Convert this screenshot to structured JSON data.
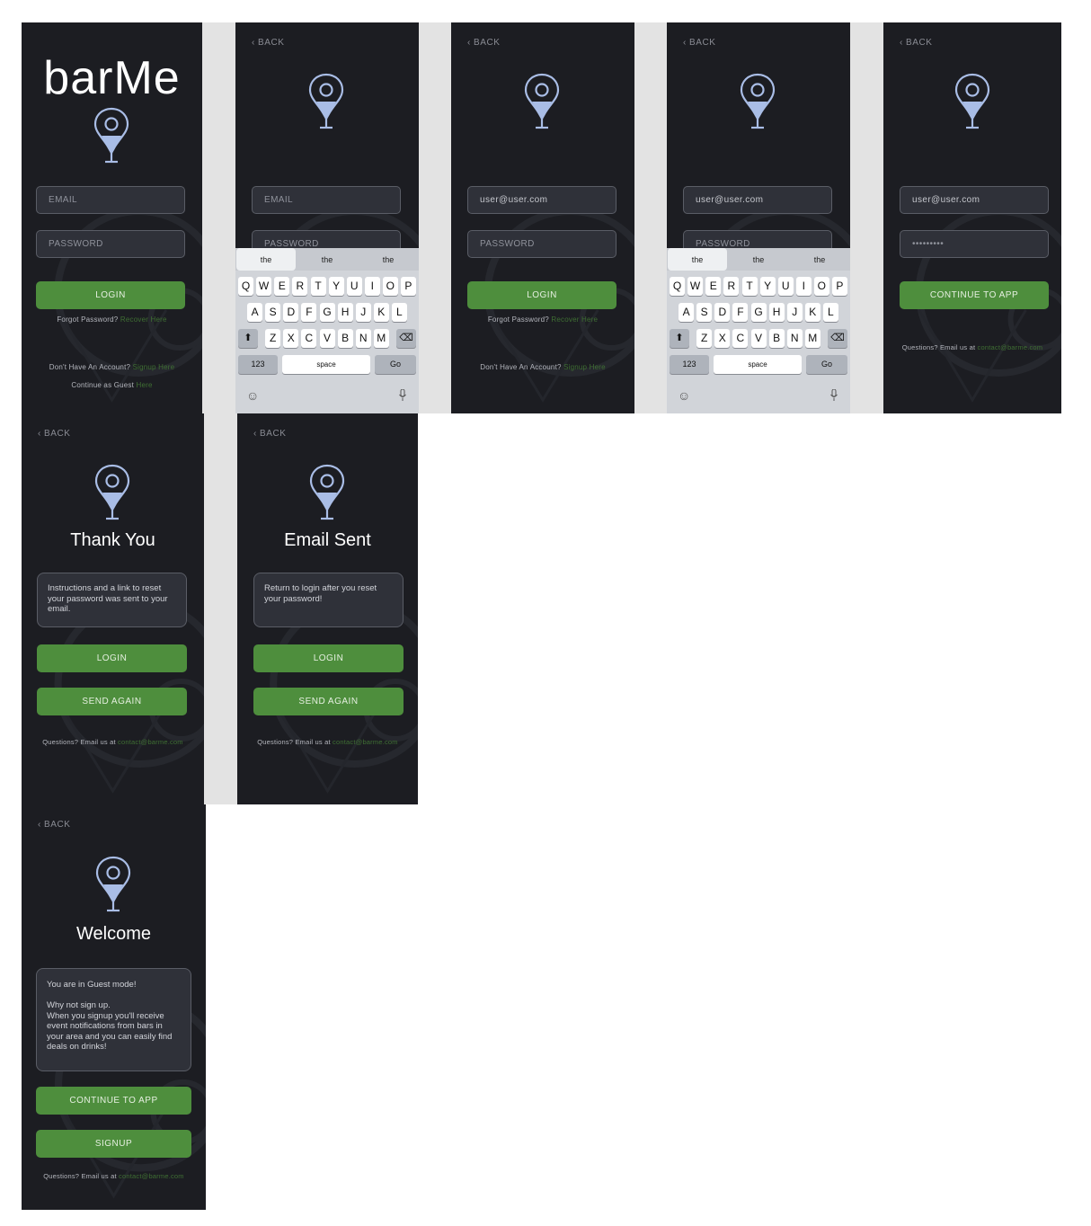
{
  "app": {
    "brand": "barMe",
    "back_label": "BACK",
    "email_placeholder": "EMAIL",
    "password_placeholder": "PASSWORD",
    "user_email": "user@user.com",
    "password_masked": "•••••••••",
    "login_label": "LOGIN",
    "continue_label": "CONTINUE TO APP",
    "send_again_label": "SEND AGAIN",
    "signup_label": "SIGNUP",
    "forgot_text": "Forgot Password?",
    "recover_link": "Recover Here",
    "no_account_text": "Don't Have An Account?",
    "signup_link": "Signup Here",
    "guest_text": "Continue as Guest",
    "guest_link": "Here",
    "questions_text": "Questions? Email us at",
    "contact_email": "contact@barme.com"
  },
  "keyboard": {
    "suggestions": [
      "the",
      "the",
      "the"
    ],
    "row1": [
      "Q",
      "W",
      "E",
      "R",
      "T",
      "Y",
      "U",
      "I",
      "O",
      "P"
    ],
    "row2": [
      "A",
      "S",
      "D",
      "F",
      "G",
      "H",
      "J",
      "K",
      "L"
    ],
    "row3": [
      "Z",
      "X",
      "C",
      "V",
      "B",
      "N",
      "M"
    ],
    "numbers_label": "123",
    "space_label": "space",
    "go_label": "Go"
  },
  "thank_you": {
    "title": "Thank You",
    "message": "Instructions and a link to reset your password was sent to your email."
  },
  "email_sent": {
    "title": "Email Sent",
    "message": "Return to login after you reset your password!"
  },
  "welcome": {
    "title": "Welcome",
    "message": "You are in Guest mode!\n\nWhy not sign up.\nWhen you signup you'll receive event notifications from bars in your area and you can easily find deals on drinks!"
  },
  "colors": {
    "background": "#1c1d22",
    "accent_green": "#4e8e3d",
    "pin_blue": "#a9bde6",
    "link_green": "#3f6f33"
  },
  "icons": [
    "map-pin-glass-icon",
    "chevron-left-icon",
    "shift-icon",
    "backspace-icon",
    "emoji-icon",
    "microphone-icon"
  ]
}
